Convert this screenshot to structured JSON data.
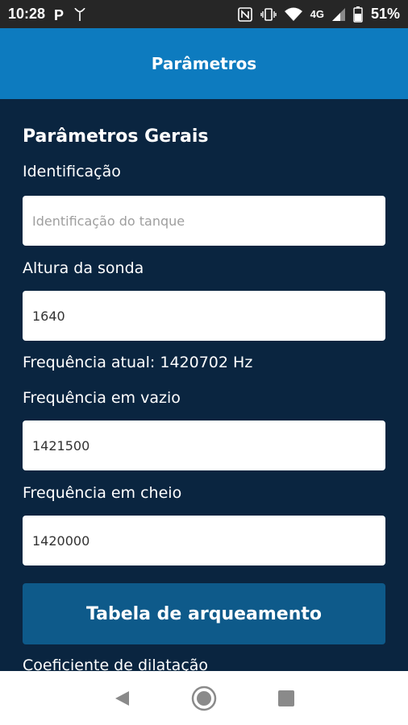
{
  "status_bar": {
    "time": "10:28",
    "network": "4G",
    "battery": "51%",
    "icons": [
      "parking-icon",
      "signal-alt-icon",
      "nfc-icon",
      "vibrate-icon",
      "wifi-icon",
      "cell-signal-icon",
      "battery-icon"
    ]
  },
  "header": {
    "title": "Parâmetros"
  },
  "form": {
    "section_title": "Parâmetros Gerais",
    "identificacao": {
      "label": "Identificação",
      "placeholder": "Identificação do tanque",
      "value": ""
    },
    "altura": {
      "label": "Altura da sonda",
      "value": "1640"
    },
    "frequencia_atual": "Frequência atual: 1420702 Hz",
    "freq_vazio": {
      "label": "Frequência em vazio",
      "value": "1421500"
    },
    "freq_cheio": {
      "label": "Frequência em cheio",
      "value": "1420000"
    },
    "tabela_button": "Tabela de arqueamento",
    "coeficiente_label": "Coeficiente de dilatação"
  },
  "nav": {
    "icons": [
      "back-icon",
      "home-icon",
      "recents-icon"
    ]
  },
  "colors": {
    "header": "#0d7bbf",
    "background": "#0a2540",
    "button": "#0e5a8a"
  }
}
